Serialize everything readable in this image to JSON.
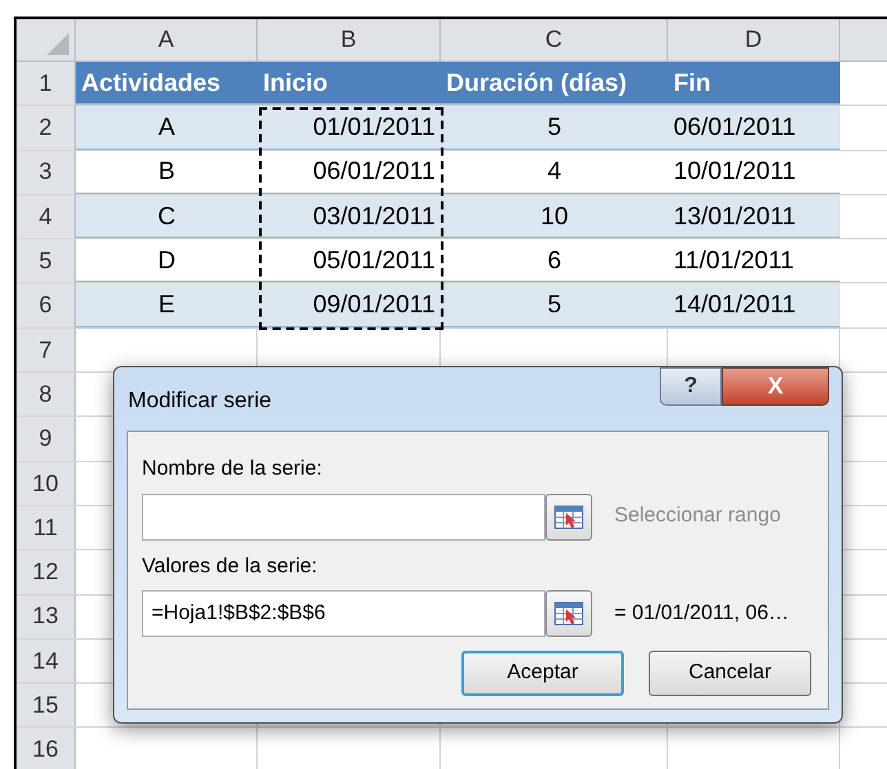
{
  "columns": [
    "A",
    "B",
    "C",
    "D"
  ],
  "rows": [
    {
      "number": "1",
      "kind": "header",
      "cells": [
        "Actividades",
        "Inicio",
        "Duración (días)",
        "Fin"
      ]
    },
    {
      "number": "2",
      "kind": "data",
      "shaded": true,
      "cells": [
        "A",
        "01/01/2011",
        "5",
        "06/01/2011"
      ]
    },
    {
      "number": "3",
      "kind": "data",
      "shaded": false,
      "cells": [
        "B",
        "06/01/2011",
        "4",
        "10/01/2011"
      ]
    },
    {
      "number": "4",
      "kind": "data",
      "shaded": true,
      "cells": [
        "C",
        "03/01/2011",
        "10",
        "13/01/2011"
      ]
    },
    {
      "number": "5",
      "kind": "data",
      "shaded": false,
      "cells": [
        "D",
        "05/01/2011",
        "6",
        "11/01/2011"
      ]
    },
    {
      "number": "6",
      "kind": "data",
      "shaded": true,
      "cells": [
        "E",
        "09/01/2011",
        "5",
        "14/01/2011"
      ]
    },
    {
      "number": "7",
      "kind": "empty"
    },
    {
      "number": "8",
      "kind": "empty"
    },
    {
      "number": "9",
      "kind": "empty"
    },
    {
      "number": "10",
      "kind": "empty"
    },
    {
      "number": "11",
      "kind": "empty"
    },
    {
      "number": "12",
      "kind": "empty"
    },
    {
      "number": "13",
      "kind": "empty"
    },
    {
      "number": "14",
      "kind": "empty"
    },
    {
      "number": "15",
      "kind": "empty"
    },
    {
      "number": "16",
      "kind": "empty"
    }
  ],
  "dialog": {
    "title": "Modificar serie",
    "help": "?",
    "close": "X",
    "fields": [
      {
        "label": "Nombre de la serie:",
        "hint": "Seleccionar rango",
        "disabled_hint": true
      },
      {
        "label": "Valores de la serie:",
        "value": "=Hoja1!$B$2:$B$6",
        "hint": "= 01/01/2011, 06…",
        "disabled_hint": false
      }
    ],
    "buttons": [
      {
        "label": "Aceptar",
        "selected": true
      },
      {
        "label": "Cancelar",
        "selected": false
      }
    ]
  }
}
